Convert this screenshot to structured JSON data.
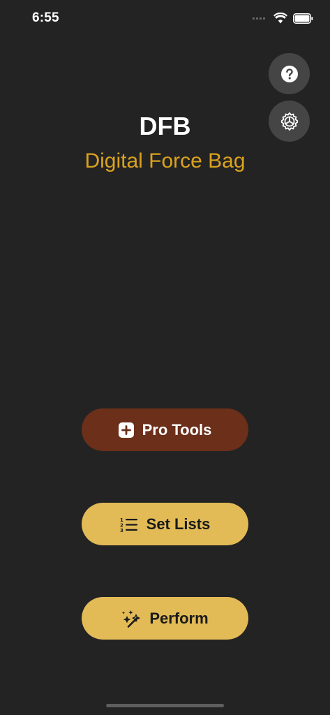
{
  "status_bar": {
    "time": "6:55",
    "signal_icon": "cellular-signal-icon",
    "wifi_icon": "wifi-icon",
    "battery_icon": "battery-icon"
  },
  "header": {
    "title": "DFB",
    "subtitle": "Digital Force Bag"
  },
  "floating_buttons": {
    "help_icon": "question-mark-icon",
    "settings_icon": "gear-icon"
  },
  "actions": {
    "pro_tools": {
      "label": "Pro Tools",
      "icon": "plus-square-icon"
    },
    "set_lists": {
      "label": "Set Lists",
      "icon": "numbered-list-icon"
    },
    "perform": {
      "label": "Perform",
      "icon": "magic-wand-sparkles-icon"
    }
  },
  "colors": {
    "background": "#232323",
    "accent_gold": "#daa21f",
    "button_gold": "#e2bb57",
    "pro_brown": "#6c2f1a",
    "circle_button": "#454545"
  }
}
